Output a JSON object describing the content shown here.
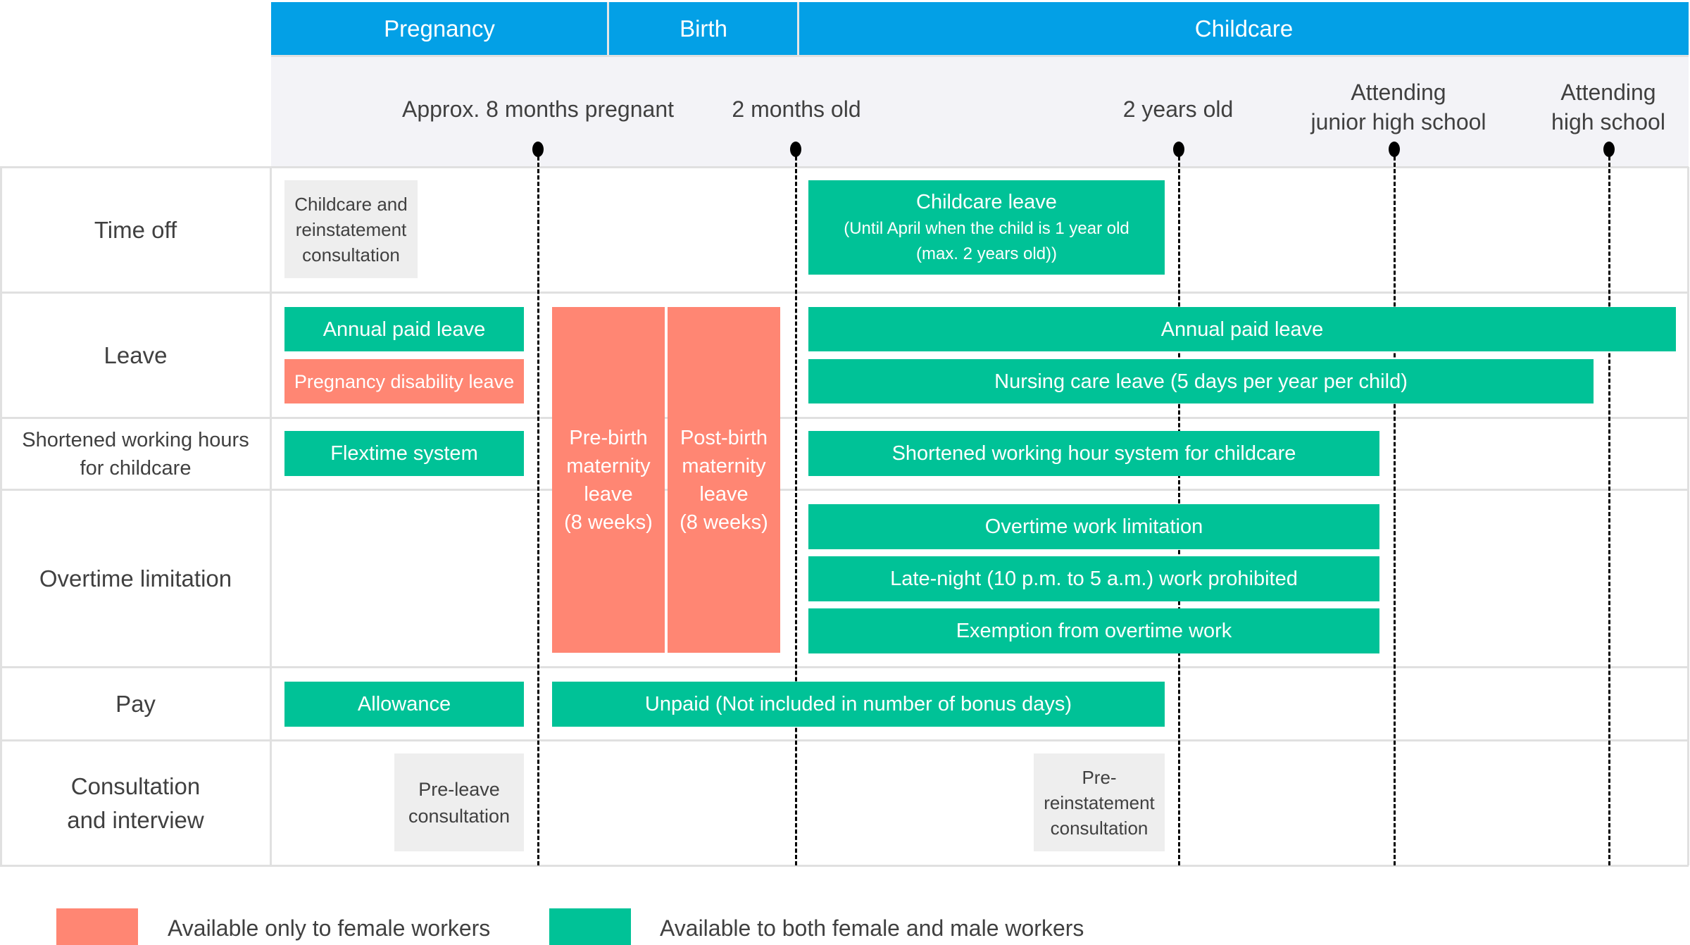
{
  "phases": [
    {
      "label": "Pregnancy"
    },
    {
      "label": "Birth"
    },
    {
      "label": "Childcare"
    }
  ],
  "timepoints": [
    {
      "label": "Approx. 8 months pregnant"
    },
    {
      "label": "2 months old"
    },
    {
      "label": "2 years old"
    },
    {
      "label_line1": "Attending",
      "label_line2": "junior high school"
    },
    {
      "label_line1": "Attending",
      "label_line2": "high school"
    }
  ],
  "rows": [
    {
      "label": "Time off"
    },
    {
      "label": "Leave"
    },
    {
      "label_line1": "Shortened working hours",
      "label_line2": "for childcare"
    },
    {
      "label": "Overtime limitation"
    },
    {
      "label": "Pay"
    },
    {
      "label_line1": "Consultation",
      "label_line2": "and interview"
    }
  ],
  "items": {
    "childcare_reinstatement_consultation": {
      "line1": "Childcare and",
      "line2": "reinstatement",
      "line3": "consultation",
      "availability": "neutral"
    },
    "childcare_leave": {
      "title": "Childcare leave",
      "sub1": "(Until April when the child is 1 year old",
      "sub2": "(max. 2 years old))",
      "availability": "both"
    },
    "annual_paid_leave_pregnancy": {
      "label": "Annual paid leave",
      "availability": "both"
    },
    "pregnancy_disability_leave": {
      "label": "Pregnancy disability leave",
      "availability": "female"
    },
    "pre_birth_maternity_leave": {
      "line1": "Pre-birth",
      "line2": "maternity",
      "line3": "leave",
      "line4": "(8 weeks)",
      "availability": "female"
    },
    "post_birth_maternity_leave": {
      "line1": "Post-birth",
      "line2": "maternity",
      "line3": "leave",
      "line4": "(8 weeks)",
      "availability": "female"
    },
    "annual_paid_leave_childcare": {
      "label": "Annual paid leave",
      "availability": "both"
    },
    "nursing_care_leave": {
      "label": "Nursing care leave (5 days per year per child)",
      "availability": "both"
    },
    "flextime_system": {
      "label": "Flextime system",
      "availability": "both"
    },
    "shortened_hour_system": {
      "label": "Shortened working hour system for childcare",
      "availability": "both"
    },
    "overtime_work_limitation": {
      "label": "Overtime work limitation",
      "availability": "both"
    },
    "late_night_prohibited": {
      "label": "Late-night (10 p.m. to 5 a.m.) work prohibited",
      "availability": "both"
    },
    "overtime_exemption": {
      "label": "Exemption from overtime work",
      "availability": "both"
    },
    "allowance": {
      "label": "Allowance",
      "availability": "both"
    },
    "unpaid": {
      "label": "Unpaid (Not included in number of bonus days)",
      "availability": "both"
    },
    "pre_leave_consultation": {
      "line1": "Pre-leave",
      "line2": "consultation",
      "availability": "neutral"
    },
    "pre_reinstatement_consultation": {
      "line1": "Pre-",
      "line2": "reinstatement",
      "line3": "consultation",
      "availability": "neutral"
    }
  },
  "legend": [
    {
      "label": "Available only to female workers",
      "color": "#FF8673"
    },
    {
      "label": "Available to both female and male workers",
      "color": "#00C297"
    }
  ],
  "colors": {
    "phase_header": "#03A0E6",
    "female_only": "#FF8673",
    "both": "#00C297",
    "consultation": "#EEEEEE",
    "timeline_band": "#F3F3F7"
  }
}
